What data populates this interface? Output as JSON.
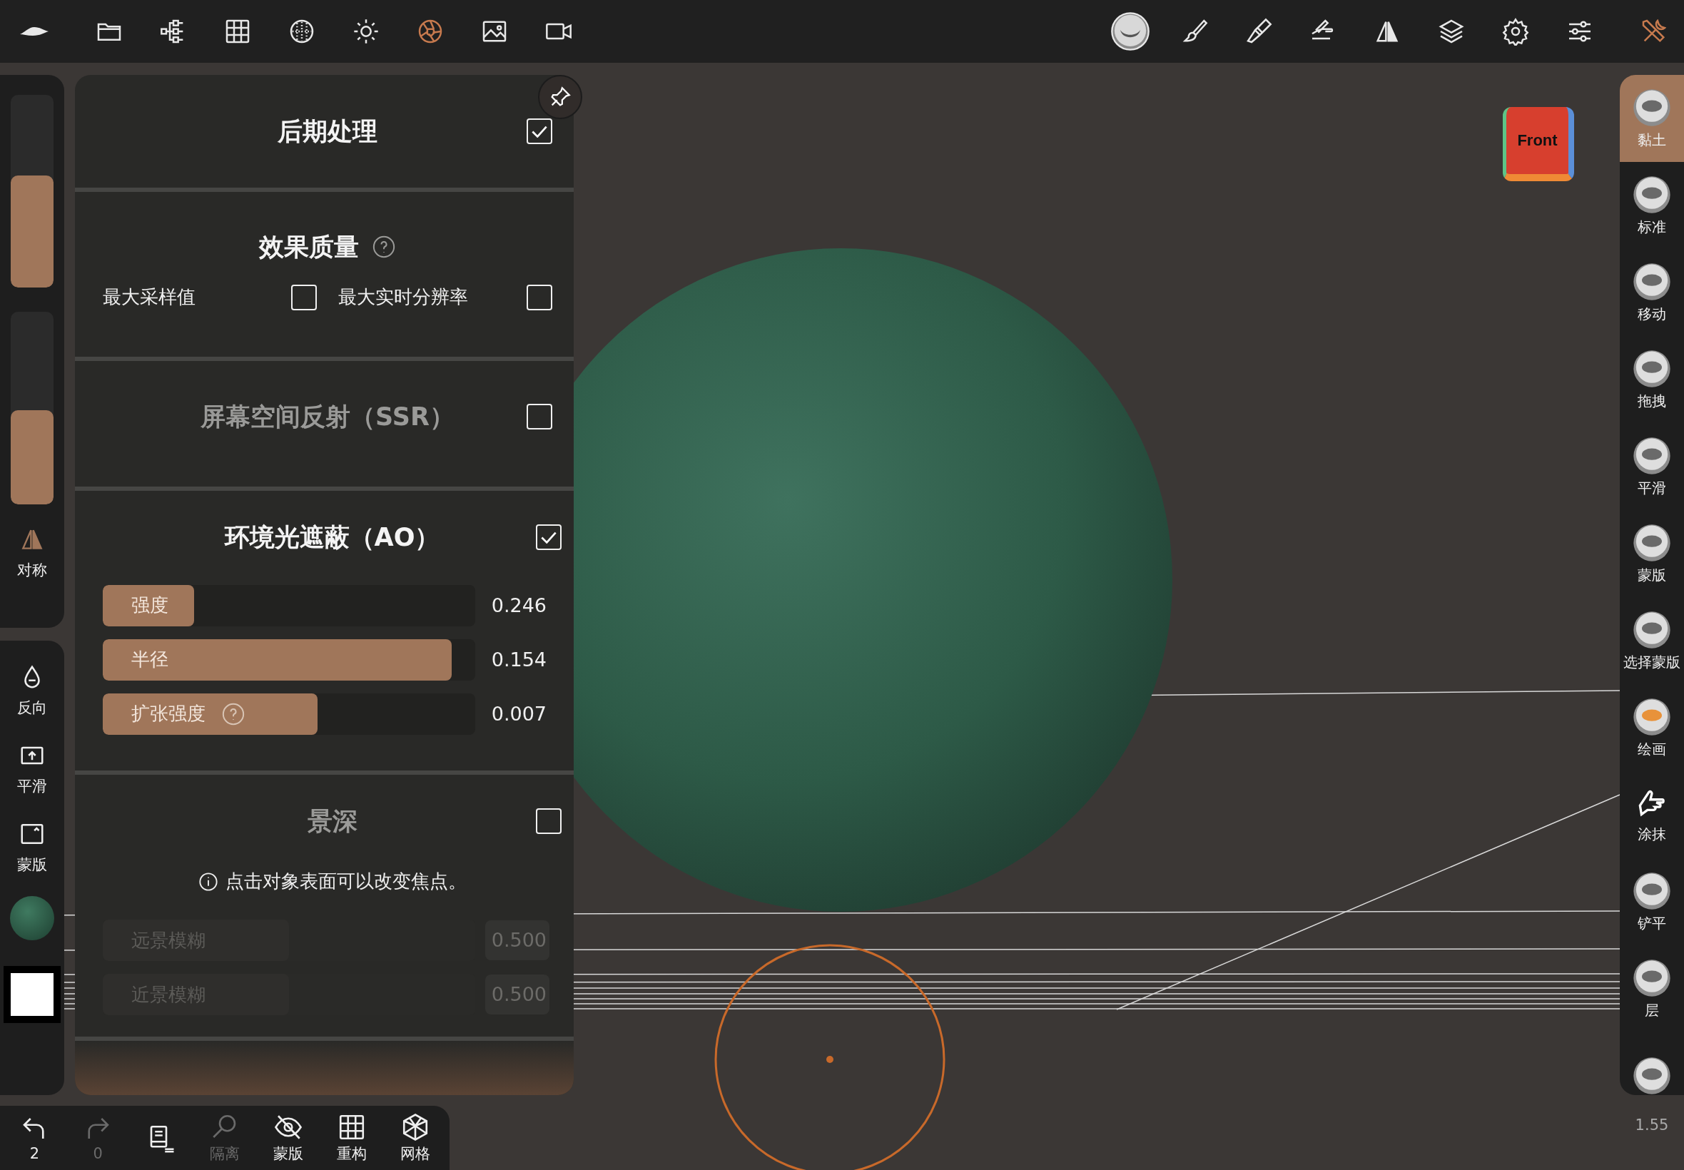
{
  "top_toolbar": {
    "left_tools": [
      {
        "selected": false
      },
      {
        "selected": false
      },
      {
        "selected": false
      },
      {
        "selected": false
      },
      {
        "selected": false
      },
      {
        "selected": false
      },
      {
        "selected": true
      },
      {
        "selected": false
      },
      {
        "selected": false
      }
    ],
    "right_tools": [
      {
        "selected": false
      },
      {
        "selected": false
      },
      {
        "selected": false
      },
      {
        "selected": false
      },
      {
        "selected": false
      },
      {
        "selected": false
      },
      {
        "selected": false
      },
      {
        "selected": false
      },
      {
        "selected": true
      }
    ]
  },
  "left_sidebar": {
    "sliders": [
      {
        "level": 0.58
      },
      {
        "level": 0.49
      }
    ],
    "symmetry": {
      "label": "对称"
    },
    "tools": [
      {
        "label": "反向"
      },
      {
        "label": "平滑"
      },
      {
        "label": "蒙版"
      }
    ]
  },
  "panel": {
    "title": "后期处理",
    "checked": true,
    "sections": [
      {
        "kind": "options",
        "title": "效果质量",
        "help": true,
        "options": [
          {
            "label": "最大采样值",
            "checked": false
          },
          {
            "label": "最大实时分辨率",
            "checked": false
          }
        ]
      },
      {
        "kind": "toggle",
        "title": "屏幕空间反射（SSR）",
        "checked": false
      },
      {
        "kind": "sliders",
        "title": "环境光遮蔽（AO）",
        "checked": true,
        "sliders": [
          {
            "label": "强度",
            "level": 0.245,
            "reading": "0.246",
            "help": false,
            "disabled": false
          },
          {
            "label": "半径",
            "level": 0.937,
            "reading": "0.154",
            "help": false,
            "disabled": false
          },
          {
            "label": "扩张强度",
            "level": 0.576,
            "reading": "0.007",
            "help": true,
            "disabled": false
          }
        ]
      },
      {
        "kind": "sliders",
        "title": "景深",
        "checked": false,
        "note": "点击对象表面可以改变焦点。",
        "sliders": [
          {
            "label": "远景模糊",
            "level": 0.5,
            "reading": "0.500",
            "help": false,
            "disabled": true
          },
          {
            "label": "近景模糊",
            "level": 0.5,
            "reading": "0.500",
            "help": false,
            "disabled": true
          }
        ]
      }
    ]
  },
  "view_cube": {
    "label": "Front"
  },
  "right_toolbar": {
    "tools": [
      {
        "label": "黏土",
        "selected": true
      },
      {
        "label": "标准",
        "selected": false
      },
      {
        "label": "移动",
        "selected": false
      },
      {
        "label": "拖拽",
        "selected": false
      },
      {
        "label": "平滑",
        "selected": false
      },
      {
        "label": "蒙版",
        "selected": false
      },
      {
        "label": "选择蒙版",
        "selected": false
      },
      {
        "label": "绘画",
        "selected": false
      },
      {
        "label": "涂抹",
        "selected": false
      },
      {
        "label": "铲平",
        "selected": false
      },
      {
        "label": "层",
        "selected": false
      },
      {
        "selected": false
      }
    ]
  },
  "bottom_bar": {
    "items": [
      {
        "label": "2",
        "disabled": false
      },
      {
        "label": "0",
        "disabled": true
      },
      {
        "disabled": false
      },
      {
        "label": "隔离",
        "disabled": true
      },
      {
        "label": "蒙版",
        "disabled": false
      },
      {
        "label": "重构",
        "disabled": false
      },
      {
        "label": "网格",
        "disabled": false
      }
    ]
  },
  "version": "1.55"
}
